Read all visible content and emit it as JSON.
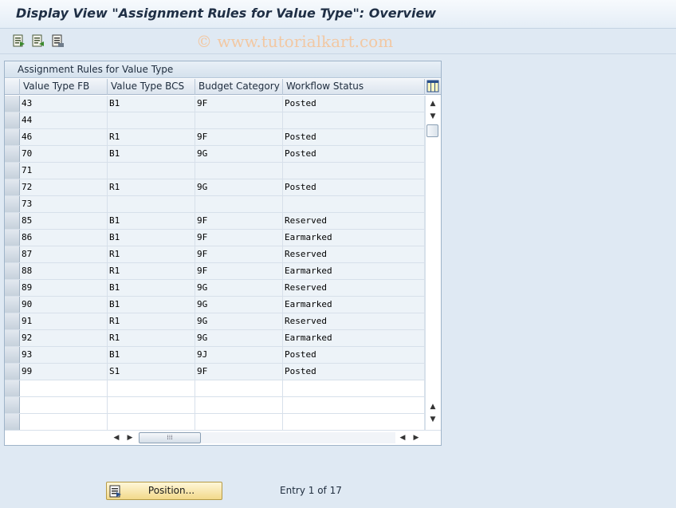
{
  "title": "Display View \"Assignment Rules for Value Type\": Overview",
  "watermark": "© www.tutorialkart.com",
  "toolbar": {
    "buttons": [
      {
        "name": "details-icon"
      },
      {
        "name": "other-view-icon"
      },
      {
        "name": "print-icon"
      }
    ]
  },
  "table": {
    "title": "Assignment Rules for Value Type",
    "columns": [
      "Value Type FB",
      "Value Type BCS",
      "Budget Category",
      "Workflow Status"
    ],
    "rows": [
      [
        "43",
        "B1",
        "9F",
        "Posted"
      ],
      [
        "44",
        "",
        "",
        ""
      ],
      [
        "46",
        "R1",
        "9F",
        "Posted"
      ],
      [
        "70",
        "B1",
        "9G",
        "Posted"
      ],
      [
        "71",
        "",
        "",
        ""
      ],
      [
        "72",
        "R1",
        "9G",
        "Posted"
      ],
      [
        "73",
        "",
        "",
        ""
      ],
      [
        "85",
        "B1",
        "9F",
        "Reserved"
      ],
      [
        "86",
        "B1",
        "9F",
        "Earmarked"
      ],
      [
        "87",
        "R1",
        "9F",
        "Reserved"
      ],
      [
        "88",
        "R1",
        "9F",
        "Earmarked"
      ],
      [
        "89",
        "B1",
        "9G",
        "Reserved"
      ],
      [
        "90",
        "B1",
        "9G",
        "Earmarked"
      ],
      [
        "91",
        "R1",
        "9G",
        "Reserved"
      ],
      [
        "92",
        "R1",
        "9G",
        "Earmarked"
      ],
      [
        "93",
        "B1",
        "9J",
        "Posted"
      ],
      [
        "99",
        "S1",
        "9F",
        "Posted"
      ],
      [
        "",
        "",
        "",
        ""
      ],
      [
        "",
        "",
        "",
        ""
      ],
      [
        "",
        "",
        "",
        ""
      ]
    ]
  },
  "footer": {
    "position_button": "Position...",
    "entry_text": "Entry 1 of 17"
  },
  "colors": {
    "background": "#dfe9f3",
    "row_filled": "#edf3f8",
    "button": "#f2d98a"
  }
}
